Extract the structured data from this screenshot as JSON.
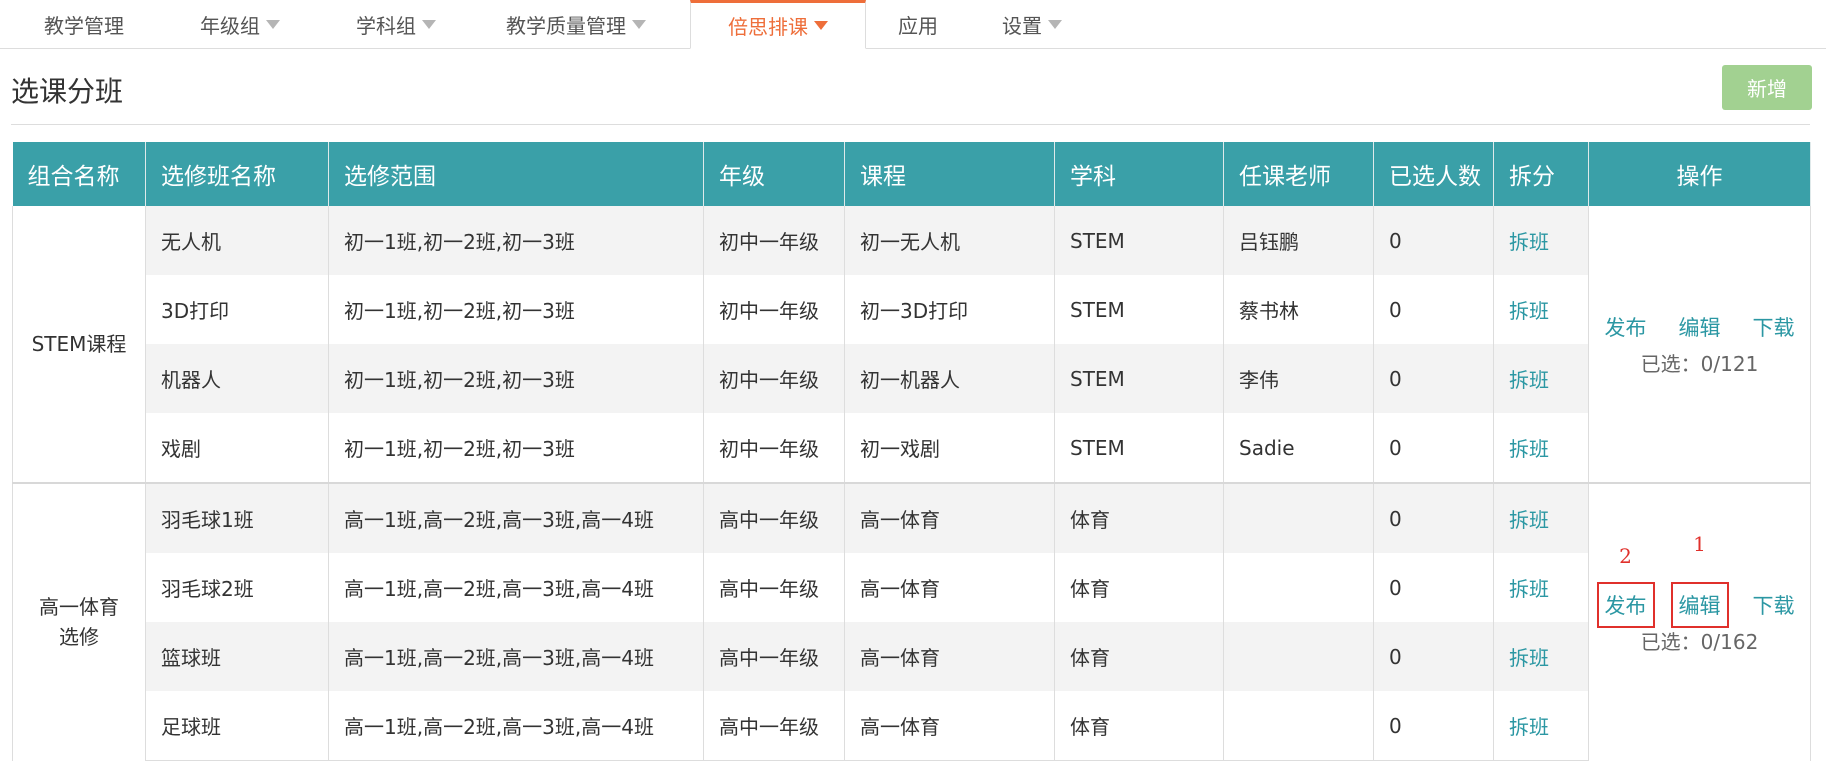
{
  "nav": {
    "items": [
      {
        "label": "教学管理",
        "has_caret": false
      },
      {
        "label": "年级组",
        "has_caret": true
      },
      {
        "label": "学科组",
        "has_caret": true
      },
      {
        "label": "教学质量管理",
        "has_caret": true
      },
      {
        "label": "倍思排课",
        "has_caret": true,
        "active": true
      },
      {
        "label": "应用",
        "has_caret": false
      },
      {
        "label": "设置",
        "has_caret": true
      }
    ]
  },
  "page": {
    "title": "选课分班",
    "add_label": "新增"
  },
  "table": {
    "columns": [
      "组合名称",
      "选修班名称",
      "选修范围",
      "年级",
      "课程",
      "学科",
      "任课老师",
      "已选人数",
      "拆分",
      "操作"
    ],
    "groups": [
      {
        "name": "STEM课程",
        "rows": [
          {
            "class": "无人机",
            "scope": "初一1班,初一2班,初一3班",
            "grade": "初中一年级",
            "course": "初一无人机",
            "subject": "STEM",
            "teacher": "吕钰鹏",
            "count": "0",
            "split": "拆班"
          },
          {
            "class": "3D打印",
            "scope": "初一1班,初一2班,初一3班",
            "grade": "初中一年级",
            "course": "初一3D打印",
            "subject": "STEM",
            "teacher": "蔡书林",
            "count": "0",
            "split": "拆班"
          },
          {
            "class": "机器人",
            "scope": "初一1班,初一2班,初一3班",
            "grade": "初中一年级",
            "course": "初一机器人",
            "subject": "STEM",
            "teacher": "李伟",
            "count": "0",
            "split": "拆班"
          },
          {
            "class": "戏剧",
            "scope": "初一1班,初一2班,初一3班",
            "grade": "初中一年级",
            "course": "初一戏剧",
            "subject": "STEM",
            "teacher": "Sadie",
            "count": "0",
            "split": "拆班"
          }
        ],
        "ops": {
          "publish": "发布",
          "edit": "编辑",
          "download": "下载",
          "selected": "已选：0/121"
        }
      },
      {
        "name": "高一体育选修",
        "rows": [
          {
            "class": "羽毛球1班",
            "scope": "高一1班,高一2班,高一3班,高一4班",
            "grade": "高中一年级",
            "course": "高一体育",
            "subject": "体育",
            "teacher": "",
            "count": "0",
            "split": "拆班"
          },
          {
            "class": "羽毛球2班",
            "scope": "高一1班,高一2班,高一3班,高一4班",
            "grade": "高中一年级",
            "course": "高一体育",
            "subject": "体育",
            "teacher": "",
            "count": "0",
            "split": "拆班"
          },
          {
            "class": "篮球班",
            "scope": "高一1班,高一2班,高一3班,高一4班",
            "grade": "高中一年级",
            "course": "高一体育",
            "subject": "体育",
            "teacher": "",
            "count": "0",
            "split": "拆班"
          },
          {
            "class": "足球班",
            "scope": "高一1班,高一2班,高一3班,高一4班",
            "grade": "高中一年级",
            "course": "高一体育",
            "subject": "体育",
            "teacher": "",
            "count": "0",
            "split": "拆班"
          }
        ],
        "ops": {
          "publish": "发布",
          "edit": "编辑",
          "download": "下载",
          "selected": "已选：0/162",
          "annot_publish": "2",
          "annot_edit": "1"
        }
      }
    ]
  },
  "colors": {
    "header": "#3aa0a8",
    "accent": "#ee6e3a",
    "link": "#2b97a3",
    "add_button": "#a2d191",
    "annotation": "#e0302b"
  }
}
